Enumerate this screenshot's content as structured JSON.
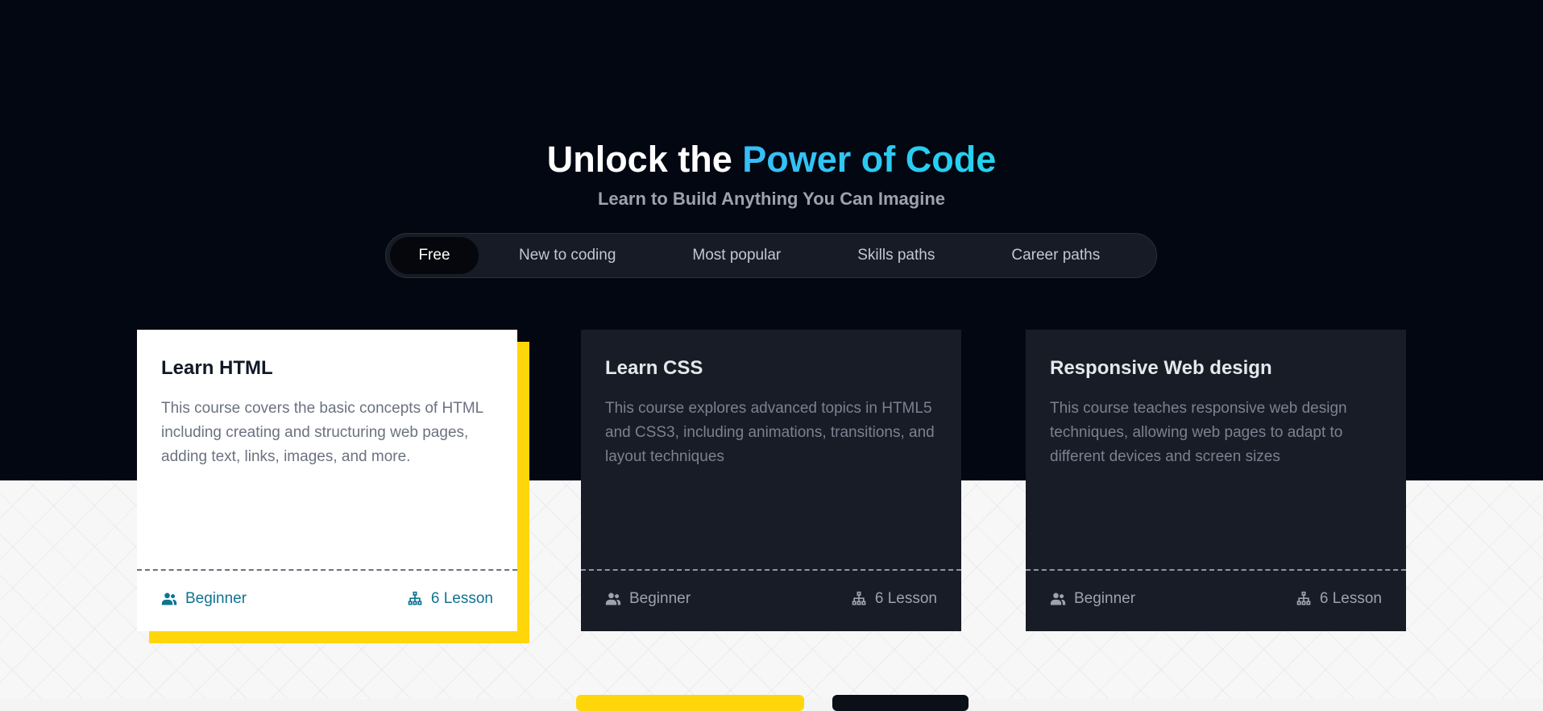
{
  "hero": {
    "title_main": "Unlock the ",
    "title_accent": "Power of Code",
    "subtitle": "Learn to Build Anything You Can Imagine"
  },
  "tabs": [
    {
      "label": "Free",
      "active": true
    },
    {
      "label": "New to coding",
      "active": false
    },
    {
      "label": "Most popular",
      "active": false
    },
    {
      "label": "Skills paths",
      "active": false
    },
    {
      "label": "Career paths",
      "active": false
    }
  ],
  "cards": [
    {
      "title": "Learn HTML",
      "description": "This course covers the basic concepts of HTML including creating and structuring web pages, adding text, links, images, and more.",
      "level": "Beginner",
      "lessons": "6 Lesson",
      "highlighted": true
    },
    {
      "title": "Learn CSS",
      "description": "This course explores advanced topics in HTML5 and CSS3, including animations, transitions, and layout techniques",
      "level": "Beginner",
      "lessons": "6 Lesson",
      "highlighted": false
    },
    {
      "title": "Responsive Web design",
      "description": "This course teaches responsive web design techniques, allowing web pages to adapt to different devices and screen sizes",
      "level": "Beginner",
      "lessons": "6 Lesson",
      "highlighted": false
    }
  ],
  "colors": {
    "hero_background": "#030712",
    "accent_cyan": "#22d3ee",
    "highlight_yellow": "#ffd60a",
    "card_dark": "#171c26",
    "meta_teal": "#0e7490"
  },
  "icons": {
    "level": "users-icon",
    "lessons": "sitemap-icon"
  }
}
